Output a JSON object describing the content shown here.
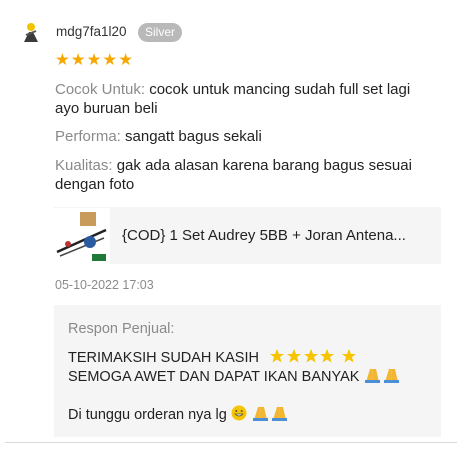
{
  "review": {
    "username": "mdg7fa1l20",
    "tier_badge": "Silver",
    "rating": 5,
    "attributes": [
      {
        "key": "Cocok Untuk:",
        "value": "cocok untuk mancing sudah full set lagi ayo buruan beli"
      },
      {
        "key": "Performa:",
        "value": "sangatt bagus sekali"
      },
      {
        "key": "Kualitas:",
        "value": "gak ada alasan karena barang bagus sesuai dengan foto"
      }
    ],
    "product": {
      "title": "{COD} 1 Set Audrey 5BB + Joran Antena..."
    },
    "timestamp": "05-10-2022 17:03"
  },
  "seller_reply": {
    "label": "Respon Penjual:",
    "line1": "TERIMAKSIH  SUDAH KASIH",
    "line2": "SEMOGA AWET DAN DAPAT IKAN BANYAK",
    "line3": "Di tunggu orderan nya lg"
  },
  "colors": {
    "star": "#f6a800",
    "badge": "#b9b9b9",
    "muted_text": "#8a8a8a",
    "card_bg": "#f5f5f5"
  }
}
